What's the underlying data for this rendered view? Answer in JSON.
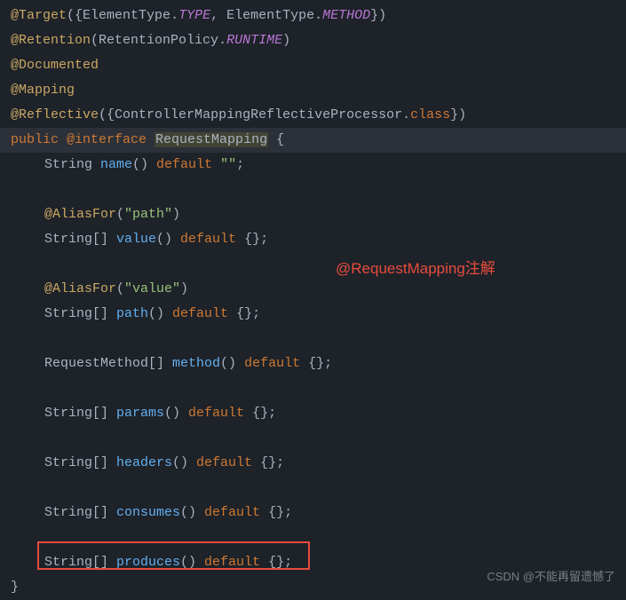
{
  "annotation_label": "@RequestMapping注解",
  "watermark": "CSDN @不能再留遗憾了",
  "line1": {
    "target": "@Target",
    "open": "({",
    "et1": "ElementType",
    "dot1": ".",
    "type": "TYPE",
    "comma": ", ",
    "et2": "ElementType",
    "dot2": ".",
    "method": "METHOD",
    "close": "})"
  },
  "line2": {
    "retention": "@Retention",
    "open": "(",
    "rp": "RetentionPolicy",
    "dot": ".",
    "runtime": "RUNTIME",
    "close": ")"
  },
  "line3": {
    "doc": "@Documented"
  },
  "line4": {
    "map": "@Mapping"
  },
  "line5": {
    "refl": "@Reflective",
    "open": "({",
    "cls": "ControllerMappingReflectiveProcessor",
    "dot": ".",
    "class": "class",
    "close": "})"
  },
  "line6": {
    "public": "public ",
    "interface": "@interface ",
    "name": "RequestMapping",
    "brace": " {"
  },
  "line7": {
    "type": "String ",
    "name": "name",
    "parens": "() ",
    "default": "default ",
    "val": "\"\"",
    "semi": ";"
  },
  "line9": {
    "alias": "@AliasFor",
    "open": "(",
    "val": "\"path\"",
    "close": ")"
  },
  "line10": {
    "type": "String[] ",
    "name": "value",
    "parens": "() ",
    "default": "default ",
    "val": "{}",
    "semi": ";"
  },
  "line12": {
    "alias": "@AliasFor",
    "open": "(",
    "val": "\"value\"",
    "close": ")"
  },
  "line13": {
    "type": "String[] ",
    "name": "path",
    "parens": "() ",
    "default": "default ",
    "val": "{}",
    "semi": ";"
  },
  "line15": {
    "type": "RequestMethod[] ",
    "name": "method",
    "parens": "() ",
    "default": "default ",
    "val": "{}",
    "semi": ";"
  },
  "line17": {
    "type": "String[] ",
    "name": "params",
    "parens": "() ",
    "default": "default ",
    "val": "{}",
    "semi": ";"
  },
  "line19": {
    "type": "String[] ",
    "name": "headers",
    "parens": "() ",
    "default": "default ",
    "val": "{}",
    "semi": ";"
  },
  "line21": {
    "type": "String[] ",
    "name": "consumes",
    "parens": "() ",
    "default": "default ",
    "val": "{}",
    "semi": ";"
  },
  "line23": {
    "type": "String[] ",
    "name": "produces",
    "parens": "() ",
    "default": "default ",
    "val": "{}",
    "semi": ";"
  },
  "line24": {
    "brace": "}"
  }
}
